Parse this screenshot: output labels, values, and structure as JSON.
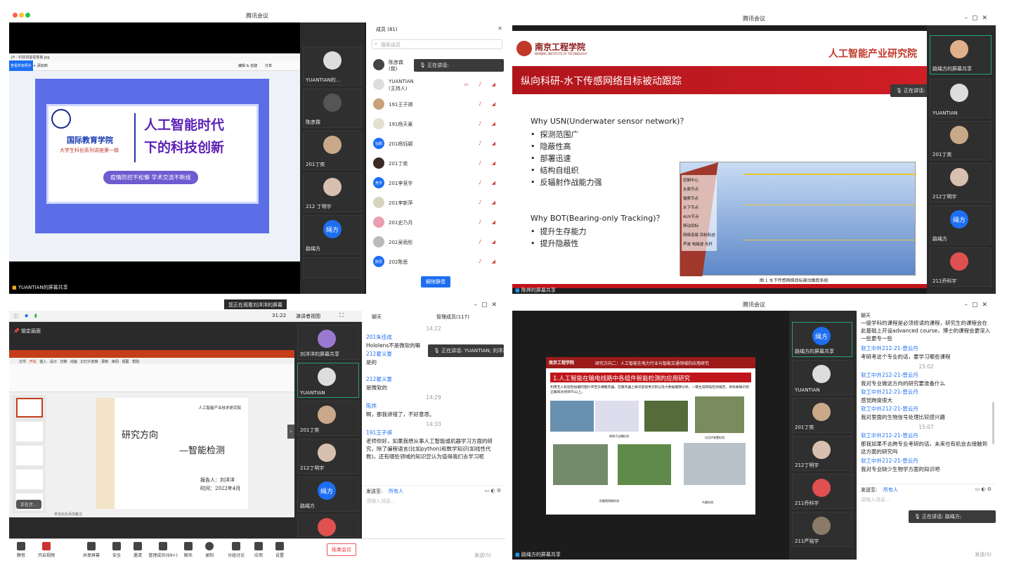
{
  "q1": {
    "window_title": "腾讯会议",
    "viewer": {
      "file": "JH - 科技讲座视像第.jpg",
      "tab": "查看所有照片",
      "add": "+ 添加到",
      "edit": "编辑 & 创建",
      "share": "分享"
    },
    "poster": {
      "school": "国际教育学院",
      "series": "大学生科创系列讲座第一辑",
      "title1": "人工智能时代",
      "title2": "下的科技创新",
      "slogan": "疫情防控不松懈 学术交流不断线"
    },
    "share_label": "YUANTIAN的屏幕共享",
    "tiles": [
      "YUANTIAN的...",
      "陈彦霖",
      "201丁奕",
      "212 丁明宇",
      "路绳方",
      ""
    ],
    "tile_avatar_text": "绳方",
    "members": {
      "header": "成员 (81)",
      "search_placeholder": "搜索成员",
      "speaking": "正在讲话:",
      "list": [
        {
          "name": "陈彦霖",
          "sub": "(我)"
        },
        {
          "name": "YUANTIAN",
          "sub": "(主持人)"
        },
        {
          "name": "191王子祺",
          "sub": ""
        },
        {
          "name": "191杨天豪",
          "sub": ""
        },
        {
          "name": "201杨钰颖",
          "sub": "",
          "avatar": "钰颖"
        },
        {
          "name": "201丁奕",
          "sub": ""
        },
        {
          "name": "201李竞宇",
          "sub": "",
          "avatar": "竞宇"
        },
        {
          "name": "201李新萍",
          "sub": ""
        },
        {
          "name": "201史乃月",
          "sub": ""
        },
        {
          "name": "201吴雨彤",
          "sub": ""
        },
        {
          "name": "202陈思",
          "sub": "",
          "avatar": "陈思"
        }
      ],
      "unmute_all": "解除静音"
    }
  },
  "q2": {
    "window_title": "腾讯会议",
    "logo": "南京工程学院",
    "logo_en": "NANJING INSTITUTE OF TECHNOLOGY",
    "institute": "人工智能产业研究院",
    "slide_title": "纵向科研-水下传感网络目标被动跟踪",
    "why1": "Why USN(Underwater sensor network)？",
    "bullets1": [
      "探测范围广",
      "隐蔽性高",
      "部署迅速",
      "结构自组织",
      "反辐射作战能力强"
    ],
    "why2": "Why BOT(Bearing-only Tracking)？",
    "bullets2": [
      "提升生存能力",
      "提升隐蔽性"
    ],
    "legend": [
      "控制中心",
      "水面节点",
      "锚索节点",
      "水下节点",
      "AUV节点",
      "移动目标",
      "网络连接",
      "目标轨迹",
      "声波",
      "电磁波",
      "光纤"
    ],
    "caption": "图 1 水下传感网络目标被动跟踪系统",
    "speaking": "正在讲话: 陈烨",
    "share_label": "陈烨的屏幕共享",
    "tiles": [
      "路绳方的屏幕共享",
      "YUANTIAN",
      "201丁奕",
      "212丁明宇",
      "路绳方",
      "211乔科宇"
    ],
    "tile_avatar_text": "绳方"
  },
  "q3": {
    "viewing": "您正在观看刘洋洋的屏幕",
    "time": "31:22",
    "view_mode": "演讲者视图",
    "lock": "锁定画面",
    "ppt_tabs": [
      "文件",
      "开始",
      "插入",
      "设计",
      "切换",
      "动画",
      "幻灯片放映",
      "录制",
      "审阅",
      "视图",
      "帮助"
    ],
    "slide": {
      "header": "人工智能产业技术研究院",
      "title1": "研究方向",
      "title2": "—智能检测",
      "reporter": "报告人：刘洋洋",
      "date": "时间：2022年4月"
    },
    "notes": "单击此处添加备注",
    "mini_bar": "正在计...",
    "tiles": [
      "刘洋洋的屏幕共享",
      "YUANTIAN",
      "201丁奕",
      "212丁明宇",
      "路绳方",
      ""
    ],
    "tile_avatar_text": "绳方",
    "chat": {
      "header": "聊天",
      "members_tab": "管理成员(117)",
      "speaking": "正在讲话: YUANTIAN; 刘洋洋",
      "lines": [
        {
          "t": "time",
          "v": "14:22"
        },
        {
          "t": "name",
          "v": "201朱佳成"
        },
        {
          "t": "msg",
          "v": "Hololens不是微软的嘛"
        },
        {
          "t": "name",
          "v": "212翟义豪"
        },
        {
          "t": "msg",
          "v": "是的"
        },
        {
          "t": "name",
          "v": "212翟义豪"
        },
        {
          "t": "msg",
          "v": "是微软的"
        },
        {
          "t": "time",
          "v": "14:29"
        },
        {
          "t": "name",
          "v": "陈烨"
        },
        {
          "t": "msg",
          "v": "啊，那我讲错了，不好意思。"
        },
        {
          "t": "time",
          "v": "14:33"
        },
        {
          "t": "name",
          "v": "191王子祺"
        },
        {
          "t": "msg",
          "v": "老师你好，如果我想从事人工智能或机器学习方面的研究，除了编程语言(比如python)和数学知识(如线性代数)，还有哪些领域的知识您认为值得我们去学习呢"
        }
      ],
      "send_to": "发送至:",
      "send_target": "所有人",
      "input_placeholder": "请输入消息...",
      "send": "发送(S)"
    },
    "toolbar": [
      "静音",
      "开启视频",
      "共享屏幕",
      "安全",
      "邀请",
      "管理成员(99+)",
      "聊天",
      "录制",
      "分组讨论",
      "应用",
      "设置"
    ],
    "end": "结束会议"
  },
  "q4": {
    "window_title": "腾讯会议",
    "slide": {
      "header": "研究方向二：人工智能在电力行业与智能交通领域的应用研究",
      "title": "1.人工智能在输电线路中各组件智能检测的应用研究",
      "desc": "利用无人机巡检拍摄的图片传至云端服务器，在服务器上做深度视觉识别以及大数据健康分析，一键生成缺陷检测报告，目标故障识别正确率达到90%以上。",
      "caps": [
        "绝缘子自爆检测",
        "均压环装置检测",
        "防震锤滑移检测",
        "鸟巢检测"
      ]
    },
    "speaking": "正在讲话: 路绳方;",
    "share_label": "路绳方的屏幕共享",
    "tiles": [
      "路绳方的屏幕共享",
      "YUANTIAN",
      "201丁奕",
      "212丁明宇",
      "211乔科宇",
      "211严铭宇"
    ],
    "tile_avatar_text": "绳方",
    "chat": {
      "header": "聊天",
      "lines": [
        {
          "t": "msg",
          "v": "一级学科的课程是必须修读的课程，研究生的课程会在此基础上开设advanced course，博士的课程会更深入一些更专一些"
        },
        {
          "t": "name",
          "v": "软工中外212-21-曾云丹"
        },
        {
          "t": "msg",
          "v": "考研考这个专业的话，要学习哪些课程"
        },
        {
          "t": "time",
          "v": "15:02"
        },
        {
          "t": "name",
          "v": "软工中外212-21-曾云丹"
        },
        {
          "t": "msg",
          "v": "我对专业做这方向的研究要准备什么"
        },
        {
          "t": "name",
          "v": "软工中外212-21-曾云丹"
        },
        {
          "t": "msg",
          "v": "感觉跨度很大"
        },
        {
          "t": "name",
          "v": "软工中外212-21-曾云丹"
        },
        {
          "t": "msg",
          "v": "我对里面的生物信号处理比较感兴趣"
        },
        {
          "t": "time",
          "v": "15:07"
        },
        {
          "t": "name",
          "v": "软工中外212-21-曾云丹"
        },
        {
          "t": "msg",
          "v": "那我如果不去跨专业考研的话，未来也有机会去接触到这方面的研究吗"
        },
        {
          "t": "name",
          "v": "软工中外212-21-曾云丹"
        },
        {
          "t": "msg",
          "v": "我对专业缺少生物学方面的知识吧"
        }
      ],
      "send_to": "发送至:",
      "send_target": "所有人",
      "input_placeholder": "请输入消息...",
      "send": "发送(S)"
    }
  }
}
